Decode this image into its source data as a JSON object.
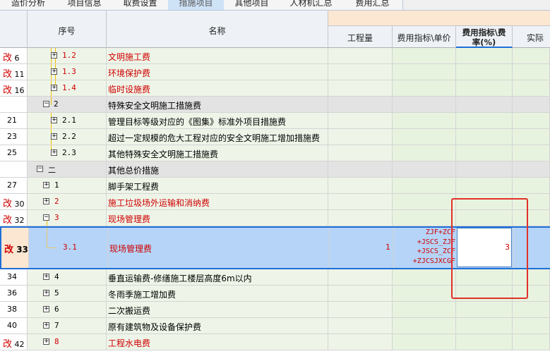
{
  "tabs": [
    "造价分析",
    "项目信息",
    "取费设置",
    "措施项目",
    "其他项目",
    "人材机汇总",
    "费用汇总"
  ],
  "columns": {
    "seq": "序号",
    "name": "名称",
    "quantity": "工程量",
    "unit_price": "费用指标\\单价",
    "rate_line1": "费用指标\\费",
    "rate_line2": "率(%)",
    "actual": "实际"
  },
  "rows": [
    {
      "mark": "改",
      "num": "6",
      "code": "1.2",
      "expander": "+",
      "name": "文明施工费",
      "red": true
    },
    {
      "mark": "改",
      "num": "11",
      "code": "1.3",
      "expander": "+",
      "name": "环境保护费",
      "red": true
    },
    {
      "mark": "改",
      "num": "16",
      "code": "1.4",
      "expander": "+",
      "name": "临时设施费",
      "red": true
    },
    {
      "mark": "",
      "num": "",
      "code": "2",
      "expander": "−",
      "name": "特殊安全文明施工措施费",
      "red": false,
      "group": true
    },
    {
      "mark": "",
      "num": "21",
      "code": "2.1",
      "expander": "+",
      "name": "管理目标等级对应的《图集》标准外项目措施费",
      "red": false
    },
    {
      "mark": "",
      "num": "23",
      "code": "2.2",
      "expander": "+",
      "name": "超过一定规模的危大工程对应的安全文明施工增加措施费",
      "red": false
    },
    {
      "mark": "",
      "num": "25",
      "code": "2.3",
      "expander": "+",
      "name": "其他特殊安全文明施工措施费",
      "red": false
    },
    {
      "mark": "",
      "num": "",
      "code": "二",
      "expander": "−",
      "name": "其他总价措施",
      "red": false,
      "group": true
    },
    {
      "mark": "",
      "num": "27",
      "code": "1",
      "expander": "+",
      "name": "脚手架工程费",
      "red": false
    },
    {
      "mark": "改",
      "num": "30",
      "code": "2",
      "expander": "+",
      "name": "施工垃圾场外运输和消纳费",
      "red": true
    },
    {
      "mark": "改",
      "num": "32",
      "code": "3",
      "expander": "−",
      "name": "现场管理费",
      "red": true
    },
    {
      "mark": "改",
      "num": "33",
      "code": "3.1",
      "expander": "",
      "name": "现场管理费",
      "red": true,
      "selected": true,
      "quantity": "1",
      "formula": [
        "ZJF+ZCF",
        "+JSCS_ZJF",
        "+JSCS_ZCF",
        "+ZJCSJXCGF"
      ],
      "rate": "3"
    },
    {
      "mark": "",
      "num": "34",
      "code": "4",
      "expander": "+",
      "name": "垂直运输费-修缮施工楼层高度6m以内",
      "red": false
    },
    {
      "mark": "",
      "num": "36",
      "code": "5",
      "expander": "+",
      "name": "冬雨季施工增加费",
      "red": false
    },
    {
      "mark": "",
      "num": "38",
      "code": "6",
      "expander": "+",
      "name": "二次搬运费",
      "red": false
    },
    {
      "mark": "",
      "num": "40",
      "code": "7",
      "expander": "+",
      "name": "原有建筑物及设备保护费",
      "red": false
    },
    {
      "mark": "改",
      "num": "42",
      "code": "8",
      "expander": "+",
      "name": "工程水电费",
      "red": true
    }
  ],
  "colors": {
    "accent": "#1e6fd9",
    "selected_row": "#b5d4f7",
    "modified": "#d00000",
    "highlight": "#e1302a"
  }
}
